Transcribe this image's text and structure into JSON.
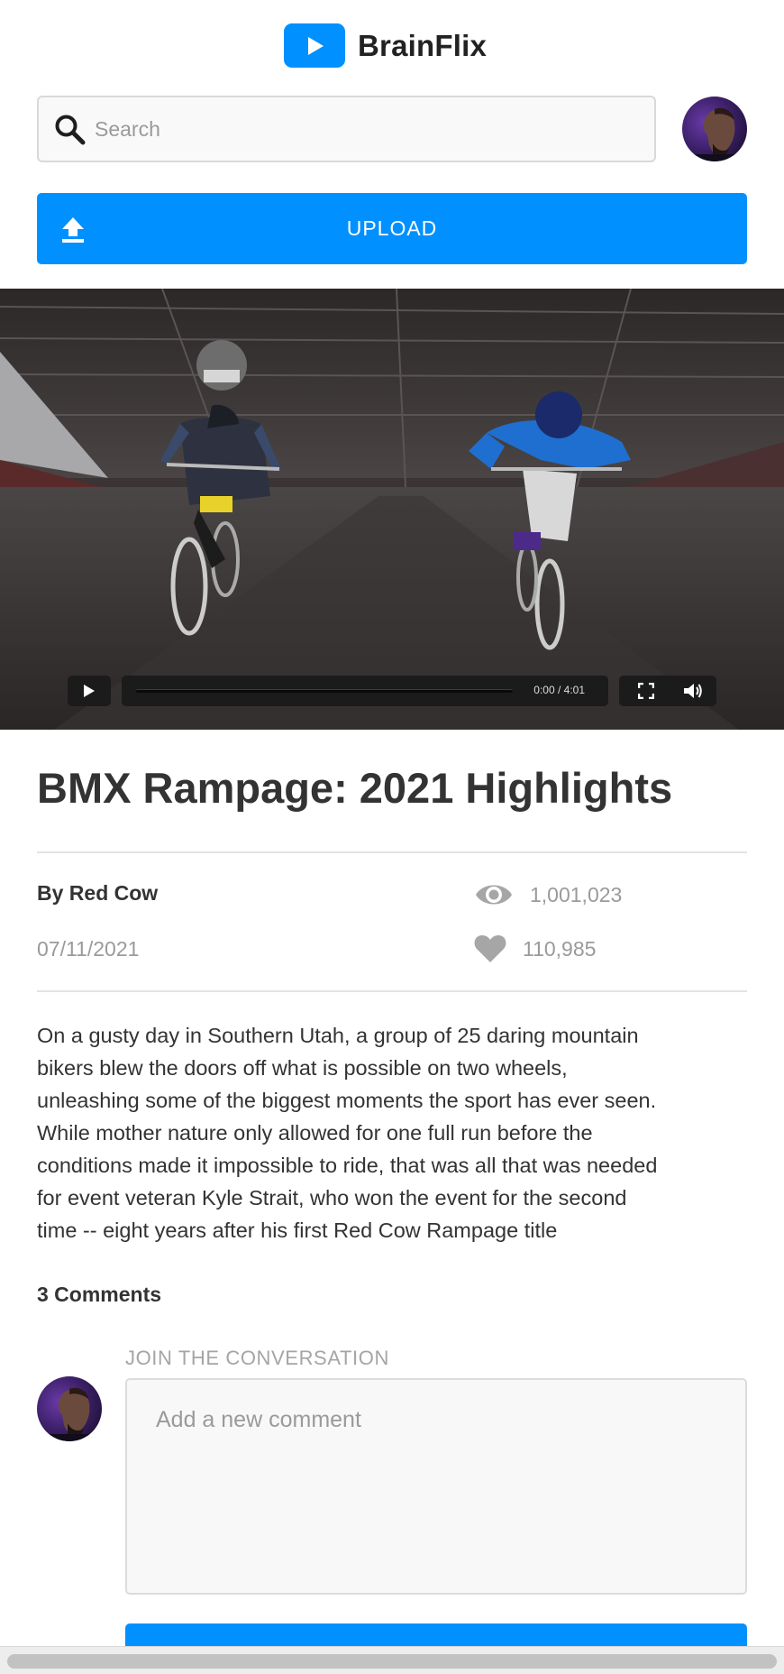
{
  "app": {
    "name": "BrainFlix",
    "logo_icon": "play-icon",
    "brand_color": "#0090ff"
  },
  "search": {
    "placeholder": "Search",
    "value": "",
    "icon": "search-icon"
  },
  "upload": {
    "label": "UPLOAD",
    "icon": "upload-icon"
  },
  "video": {
    "current_time": "0:00",
    "duration": "4:01",
    "time_display": "0:00 / 4:01",
    "progress": 0,
    "controls": [
      "play-icon",
      "fullscreen-icon",
      "volume-icon"
    ]
  },
  "details": {
    "title": "BMX Rampage: 2021 Highlights",
    "author": "By Red Cow",
    "date": "07/11/2021",
    "views": "1,001,023",
    "likes": "110,985",
    "description_lines": [
      "On a gusty day in Southern Utah, a group of 25 daring mountain",
      "bikers blew the doors off what is possible on two wheels,",
      "unleashing some of the biggest moments the sport has ever seen.",
      "While mother nature only allowed for one full run before the",
      "conditions made it impossible to ride, that was all that was needed",
      "for event veteran Kyle Strait, who won the event for the second",
      "time -- eight years after his first Red Cow Rampage title"
    ]
  },
  "comments": {
    "count_label": "3 Comments",
    "join_label": "JOIN THE CONVERSATION",
    "placeholder": "Add a new comment",
    "value": ""
  }
}
